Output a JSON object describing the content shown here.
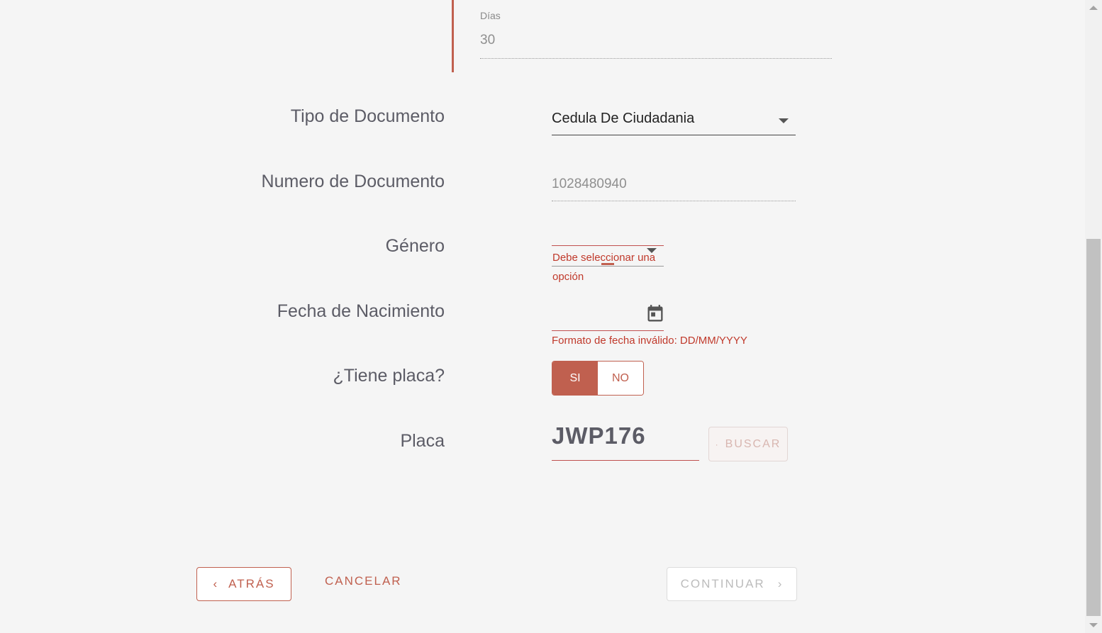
{
  "summary": {
    "dias_label": "Días",
    "dias_value": "30"
  },
  "form": {
    "tipo_documento": {
      "label": "Tipo de Documento",
      "value": "Cedula De Ciudadania"
    },
    "numero_documento": {
      "label": "Numero de Documento",
      "value": "1028480940"
    },
    "genero": {
      "label": "Género",
      "error": "Debe seleccionar una opción"
    },
    "fecha_nacimiento": {
      "label": "Fecha de Nacimiento",
      "value": "",
      "error": "Formato de fecha inválido: DD/MM/YYYY"
    },
    "tiene_placa": {
      "label": "¿Tiene placa?",
      "options": [
        "SI",
        "NO"
      ],
      "selected": "SI"
    },
    "placa": {
      "label": "Placa",
      "value": "JWP176",
      "search_label": "BUSCAR"
    }
  },
  "footer": {
    "back_label": "ATRÁS",
    "cancel_label": "CANCELAR",
    "continue_label": "CONTINUAR"
  },
  "colors": {
    "accent": "#c0604f",
    "error": "#c0392b",
    "background": "#f5f5f5"
  }
}
